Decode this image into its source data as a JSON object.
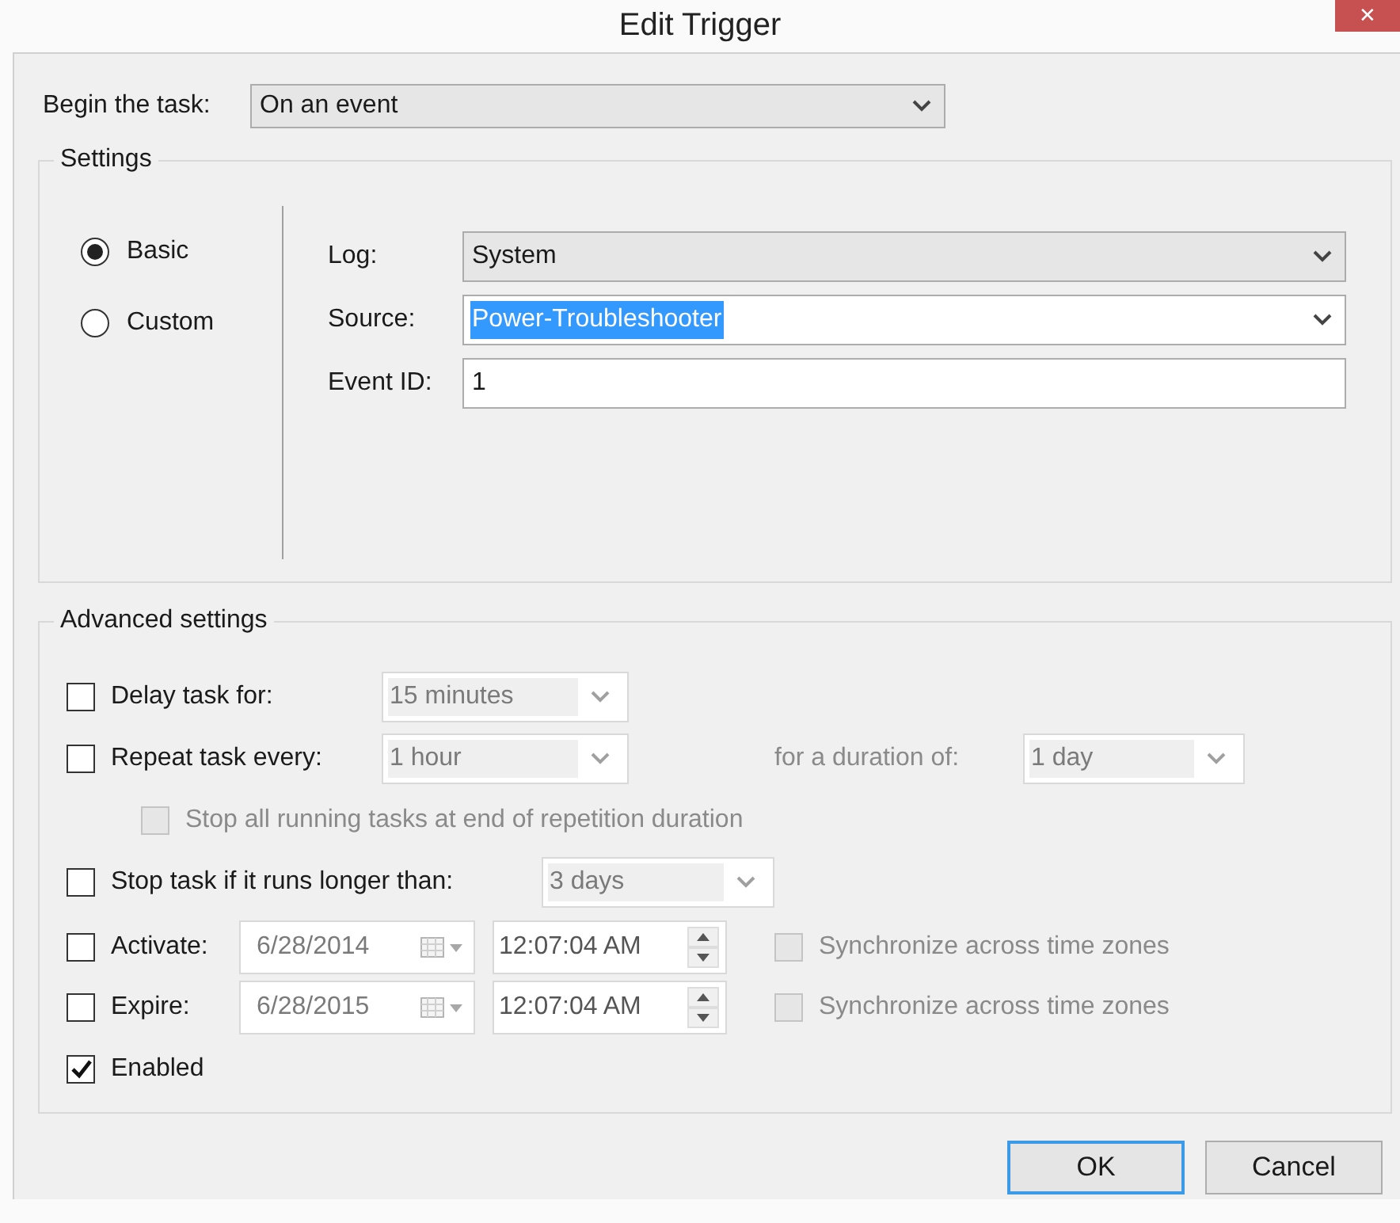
{
  "window": {
    "title": "Edit Trigger",
    "close_glyph": "✕"
  },
  "begin_task": {
    "label": "Begin the task:",
    "value": "On an event"
  },
  "settings": {
    "title": "Settings",
    "modes": [
      {
        "label": "Basic",
        "selected": true
      },
      {
        "label": "Custom",
        "selected": false
      }
    ],
    "fields": [
      {
        "kind": "dropdown",
        "label": "Log:",
        "value": "System",
        "text_selected": false
      },
      {
        "kind": "dropdown",
        "label": "Source:",
        "value": "Power-Troubleshooter",
        "text_selected": true
      },
      {
        "kind": "text",
        "label": "Event ID:",
        "value": "1",
        "text_selected": false
      }
    ]
  },
  "advanced": {
    "title": "Advanced settings",
    "delay": {
      "label": "Delay task for:",
      "checked": false,
      "value": "15 minutes",
      "disabled": true
    },
    "repeat": {
      "label": "Repeat task every:",
      "checked": false,
      "value": "1 hour",
      "disabled": true,
      "duration_label": "for a duration of:",
      "duration_value": "1 day"
    },
    "stop_all": {
      "label": "Stop all running tasks at end of repetition duration",
      "checked": false,
      "disabled": true
    },
    "stop_longer": {
      "label": "Stop task if it runs longer than:",
      "checked": false,
      "value": "3 days",
      "disabled": true
    },
    "schedule": [
      {
        "label": "Activate:",
        "checked": false,
        "date": "6/28/2014",
        "time": "12:07:04 AM",
        "sync_label": "Synchronize across time zones",
        "sync_checked": false,
        "disabled": true
      },
      {
        "label": "Expire:",
        "checked": false,
        "date": "6/28/2015",
        "time": "12:07:04 AM",
        "sync_label": "Synchronize across time zones",
        "sync_checked": false,
        "disabled": true
      }
    ],
    "enabled": {
      "label": "Enabled",
      "checked": true
    }
  },
  "buttons": [
    {
      "label": "OK",
      "default": true
    },
    {
      "label": "Cancel",
      "default": false
    }
  ]
}
